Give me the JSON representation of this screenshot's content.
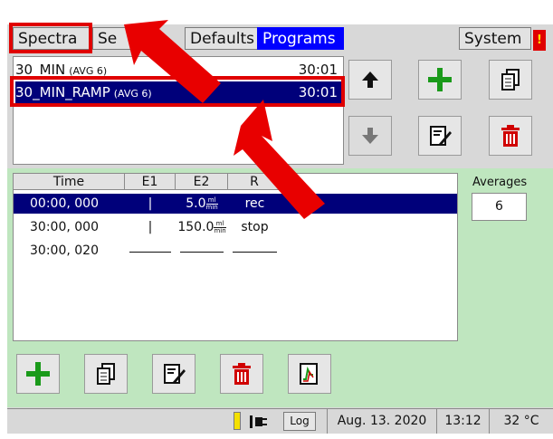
{
  "tabs": {
    "spectra": "Spectra",
    "setup": "Se",
    "defaults": "Defaults",
    "programs": "Programs",
    "system": "System",
    "alert": "!"
  },
  "programs": [
    {
      "name": "30_MIN",
      "avg": "(AVG 6)",
      "duration": "30:01",
      "selected": false
    },
    {
      "name": "30_MIN_RAMP",
      "avg": "(AVG 6)",
      "duration": "30:01",
      "selected": true
    }
  ],
  "toolbar_icons": {
    "move_up": "arrow-up-icon",
    "move_down": "arrow-down-icon",
    "add": "plus-icon",
    "copy": "copy-icon",
    "edit": "edit-icon",
    "delete": "trash-icon",
    "chart": "chart-icon"
  },
  "steps_table": {
    "headers": [
      "Time",
      "E1",
      "E2",
      "R"
    ],
    "rows": [
      {
        "time": "00:00, 000",
        "e1": "|",
        "e2": "5.0",
        "unit_top": "ml",
        "unit_bottom": "min",
        "r": "rec",
        "selected": true
      },
      {
        "time": "30:00, 000",
        "e1": "|",
        "e2": "150.0",
        "unit_top": "ml",
        "unit_bottom": "min",
        "r": "stop",
        "selected": false
      },
      {
        "time": "30:00, 020",
        "e1": "",
        "e2": "",
        "unit_top": "",
        "unit_bottom": "",
        "r": "",
        "selected": false
      }
    ]
  },
  "averages": {
    "label": "Averages",
    "value": "6"
  },
  "status": {
    "log": "Log",
    "date": "Aug. 13. 2020",
    "time": "13:12",
    "temperature": "32 °C",
    "battery_icon": "battery-icon",
    "plug_icon": "power-plug-icon"
  },
  "colors": {
    "selection": "#00007a",
    "active_tab": "#0000ff",
    "work_area": "#bfe6bf",
    "add_green": "#1a9a1a",
    "delete_red": "#d00000",
    "annotation_red": "#e00000"
  }
}
